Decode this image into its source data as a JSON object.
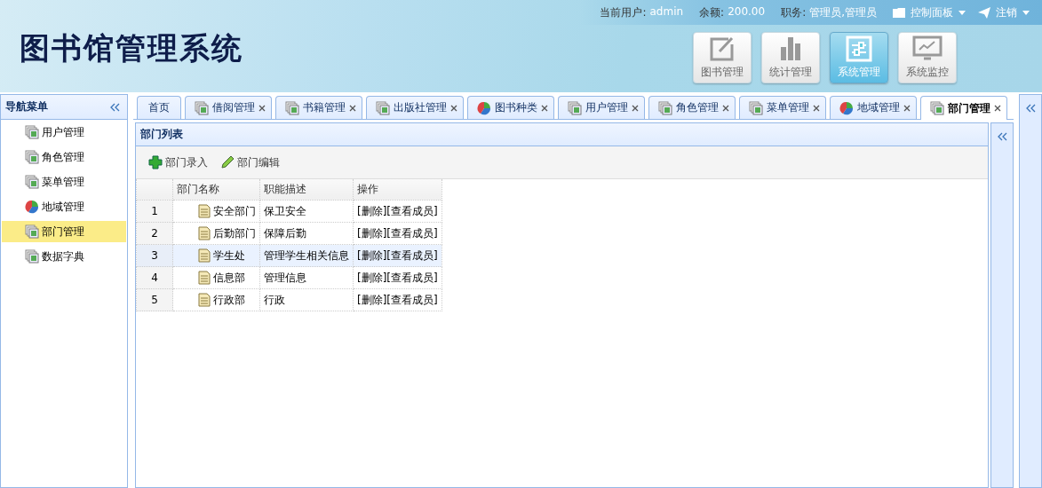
{
  "header": {
    "title": "图书馆管理系统",
    "user_label": "当前用户:",
    "user_value": "admin",
    "balance_label": "余额:",
    "balance_value": "200.00",
    "role_label": "职务:",
    "role_value": "管理员,管理员",
    "menus": [
      {
        "label": "控制面板",
        "kind": "folder"
      },
      {
        "label": "注销",
        "kind": "send"
      }
    ],
    "modules": [
      {
        "label": "图书管理",
        "kind": "edit",
        "selected": false
      },
      {
        "label": "统计管理",
        "kind": "bars",
        "selected": false
      },
      {
        "label": "系统管理",
        "kind": "sliders",
        "selected": true
      },
      {
        "label": "系统监控",
        "kind": "monitor",
        "selected": false
      }
    ]
  },
  "sidebar": {
    "title": "导航菜单",
    "items": [
      {
        "label": "用户管理",
        "kind": "pages",
        "selected": false
      },
      {
        "label": "角色管理",
        "kind": "pages",
        "selected": false
      },
      {
        "label": "菜单管理",
        "kind": "pages",
        "selected": false
      },
      {
        "label": "地域管理",
        "kind": "pie",
        "selected": false
      },
      {
        "label": "部门管理",
        "kind": "pages",
        "selected": true
      },
      {
        "label": "数据字典",
        "kind": "pages",
        "selected": false
      }
    ]
  },
  "tabs": [
    {
      "label": "首页",
      "kind": "plain",
      "closable": false,
      "selected": false
    },
    {
      "label": "借阅管理",
      "kind": "pages",
      "closable": true,
      "selected": false
    },
    {
      "label": "书籍管理",
      "kind": "pages",
      "closable": true,
      "selected": false
    },
    {
      "label": "出版社管理",
      "kind": "pages",
      "closable": true,
      "selected": false
    },
    {
      "label": "图书种类",
      "kind": "pie",
      "closable": true,
      "selected": false
    },
    {
      "label": "用户管理",
      "kind": "pages",
      "closable": true,
      "selected": false
    },
    {
      "label": "角色管理",
      "kind": "pages",
      "closable": true,
      "selected": false
    },
    {
      "label": "菜单管理",
      "kind": "pages",
      "closable": true,
      "selected": false
    },
    {
      "label": "地域管理",
      "kind": "pie",
      "closable": true,
      "selected": false
    },
    {
      "label": "部门管理",
      "kind": "pages",
      "closable": true,
      "selected": true
    }
  ],
  "panel": {
    "title": "部门列表",
    "toolbar": [
      {
        "label": "部门录入",
        "kind": "add"
      },
      {
        "label": "部门编辑",
        "kind": "pencil"
      }
    ],
    "columns": [
      "部门名称",
      "职能描述",
      "操作"
    ],
    "rows": [
      {
        "number": "1",
        "name": "安全部门",
        "description": "保卫安全",
        "actions": "[删除][查看成员]",
        "selected": false
      },
      {
        "number": "2",
        "name": "后勤部门",
        "description": "保障后勤",
        "actions": "[删除][查看成员]",
        "selected": false
      },
      {
        "number": "3",
        "name": "学生处",
        "description": "管理学生相关信息",
        "actions": "[删除][查看成员]",
        "selected": true
      },
      {
        "number": "4",
        "name": "信息部",
        "description": "管理信息",
        "actions": "[删除][查看成员]",
        "selected": false
      },
      {
        "number": "5",
        "name": "行政部",
        "description": "行政",
        "actions": "[删除][查看成员]",
        "selected": false
      }
    ]
  }
}
